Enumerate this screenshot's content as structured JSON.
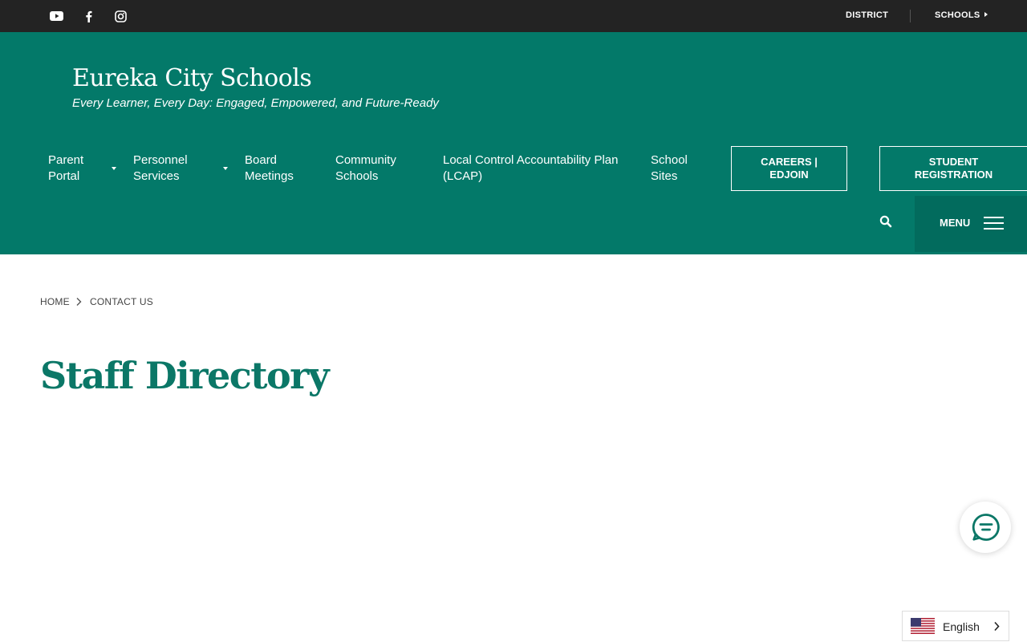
{
  "topbar": {
    "social": [
      {
        "icon": "youtube-icon"
      },
      {
        "icon": "facebook-icon"
      },
      {
        "icon": "instagram-icon"
      }
    ],
    "district_label": "DISTRICT",
    "schools_label": "SCHOOLS"
  },
  "header": {
    "site_title": "Eureka City Schools",
    "tagline": "Every Learner, Every Day: Engaged, Empowered, and Future-Ready"
  },
  "nav": {
    "parent_portal": [
      "Parent",
      "Portal"
    ],
    "personnel_services": [
      "Personnel",
      "Services"
    ],
    "board_meetings": [
      "Board",
      "Meetings"
    ],
    "community_schools": [
      "Community",
      "Schools"
    ],
    "lcap": [
      "Local Control Accountability Plan",
      "(LCAP)"
    ],
    "school_sites": [
      "School",
      "Sites"
    ],
    "careers": [
      "CAREERS |",
      "EDJOIN"
    ],
    "student_registration": [
      "STUDENT",
      "REGISTRATION"
    ],
    "search_icon": "search-icon",
    "menu_label": "MENU"
  },
  "breadcrumb": {
    "home": "HOME",
    "current": "CONTACT US"
  },
  "page": {
    "title": "Staff Directory"
  },
  "widgets": {
    "chat_icon": "chat-icon",
    "language": "English",
    "flag_icon": "us-flag-icon"
  },
  "colors": {
    "header_bg": "#037969",
    "topbar_bg": "#232323",
    "menu_bg": "#026b5d",
    "title_color": "#0b7767"
  }
}
